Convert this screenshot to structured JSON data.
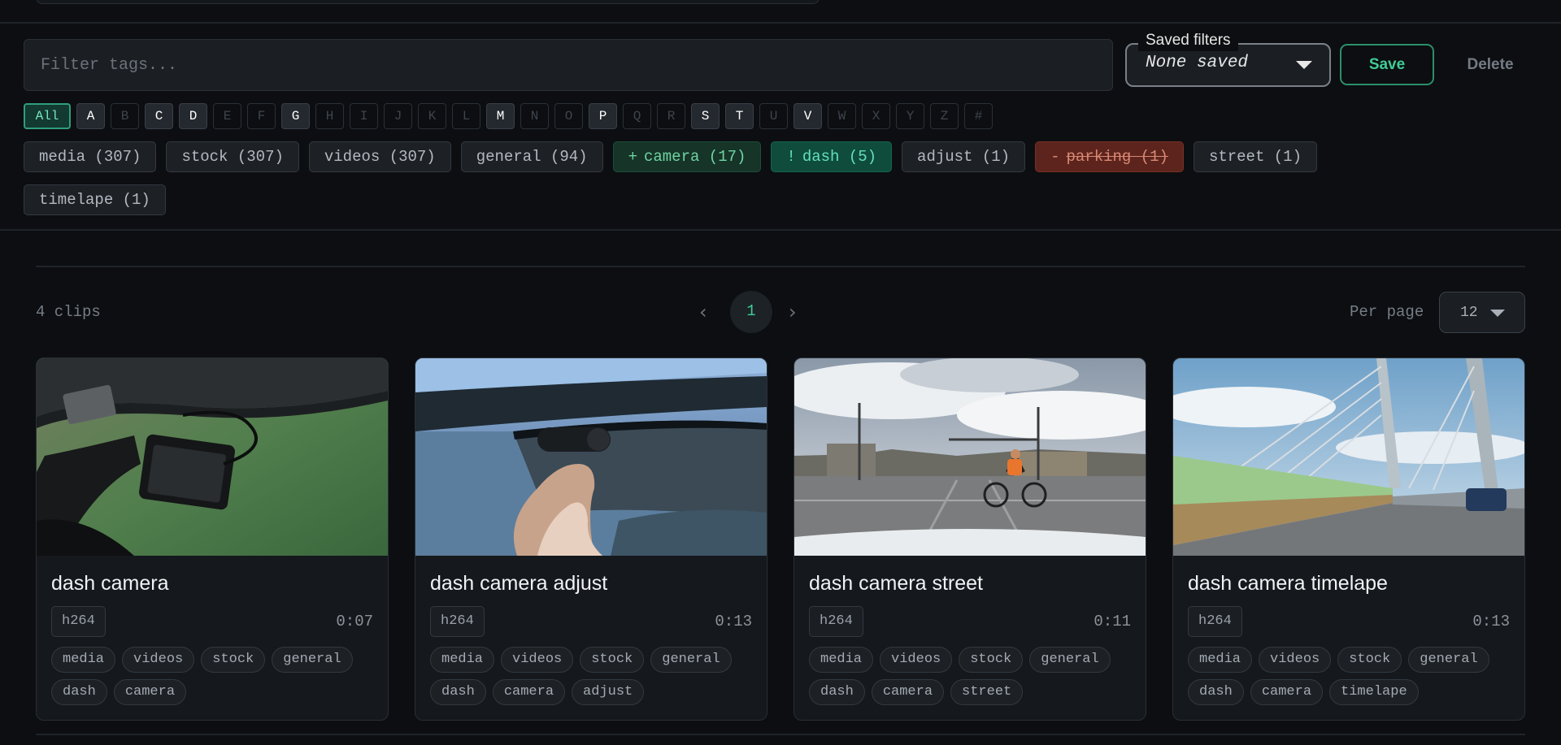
{
  "filter": {
    "placeholder": "Filter tags..."
  },
  "saved_filters": {
    "label": "Saved filters",
    "value": "None saved"
  },
  "actions": {
    "save": "Save",
    "delete": "Delete"
  },
  "letters": [
    {
      "label": "All",
      "state": "selected"
    },
    {
      "label": "A",
      "state": "enabled"
    },
    {
      "label": "B",
      "state": "disabled"
    },
    {
      "label": "C",
      "state": "enabled"
    },
    {
      "label": "D",
      "state": "enabled"
    },
    {
      "label": "E",
      "state": "disabled"
    },
    {
      "label": "F",
      "state": "disabled"
    },
    {
      "label": "G",
      "state": "enabled"
    },
    {
      "label": "H",
      "state": "disabled"
    },
    {
      "label": "I",
      "state": "disabled"
    },
    {
      "label": "J",
      "state": "disabled"
    },
    {
      "label": "K",
      "state": "disabled"
    },
    {
      "label": "L",
      "state": "disabled"
    },
    {
      "label": "M",
      "state": "enabled"
    },
    {
      "label": "N",
      "state": "disabled"
    },
    {
      "label": "O",
      "state": "disabled"
    },
    {
      "label": "P",
      "state": "enabled"
    },
    {
      "label": "Q",
      "state": "disabled"
    },
    {
      "label": "R",
      "state": "disabled"
    },
    {
      "label": "S",
      "state": "enabled"
    },
    {
      "label": "T",
      "state": "enabled"
    },
    {
      "label": "U",
      "state": "disabled"
    },
    {
      "label": "V",
      "state": "enabled"
    },
    {
      "label": "W",
      "state": "disabled"
    },
    {
      "label": "X",
      "state": "disabled"
    },
    {
      "label": "Y",
      "state": "disabled"
    },
    {
      "label": "Z",
      "state": "disabled"
    },
    {
      "label": "#",
      "state": "disabled"
    }
  ],
  "tags": [
    {
      "name": "media",
      "count": "(307)",
      "state": "neutral",
      "prefix": ""
    },
    {
      "name": "stock",
      "count": "(307)",
      "state": "neutral",
      "prefix": ""
    },
    {
      "name": "videos",
      "count": "(307)",
      "state": "neutral",
      "prefix": ""
    },
    {
      "name": "general",
      "count": "(94)",
      "state": "neutral",
      "prefix": ""
    },
    {
      "name": "camera",
      "count": "(17)",
      "state": "included",
      "prefix": "+"
    },
    {
      "name": "dash",
      "count": "(5)",
      "state": "must",
      "prefix": "!"
    },
    {
      "name": "adjust",
      "count": "(1)",
      "state": "neutral",
      "prefix": ""
    },
    {
      "name": "parking",
      "count": "(1)",
      "state": "excluded",
      "prefix": "-"
    },
    {
      "name": "street",
      "count": "(1)",
      "state": "neutral",
      "prefix": ""
    },
    {
      "name": "timelape",
      "count": "(1)",
      "state": "neutral",
      "prefix": ""
    }
  ],
  "results": {
    "count_text": "4 clips"
  },
  "pagination": {
    "current": "1",
    "prev_icon": "chevron-left-icon",
    "next_icon": "chevron-right-icon"
  },
  "per_page": {
    "label": "Per page",
    "value": "12"
  },
  "clips": [
    {
      "title": "dash camera",
      "codec": "h264",
      "duration": "0:07",
      "tags": [
        "media",
        "videos",
        "stock",
        "general",
        "dash",
        "camera"
      ],
      "thumb": "interior"
    },
    {
      "title": "dash camera adjust",
      "codec": "h264",
      "duration": "0:13",
      "tags": [
        "media",
        "videos",
        "stock",
        "general",
        "dash",
        "camera",
        "adjust"
      ],
      "thumb": "hand"
    },
    {
      "title": "dash camera street",
      "codec": "h264",
      "duration": "0:11",
      "tags": [
        "media",
        "videos",
        "stock",
        "general",
        "dash",
        "camera",
        "street"
      ],
      "thumb": "street"
    },
    {
      "title": "dash camera timelape",
      "codec": "h264",
      "duration": "0:13",
      "tags": [
        "media",
        "videos",
        "stock",
        "general",
        "dash",
        "camera",
        "timelape"
      ],
      "thumb": "bridge"
    }
  ],
  "colors": {
    "accent": "#3fcc95",
    "background": "#0c0e11",
    "excluded": "#5c241d",
    "included": "#163428"
  }
}
